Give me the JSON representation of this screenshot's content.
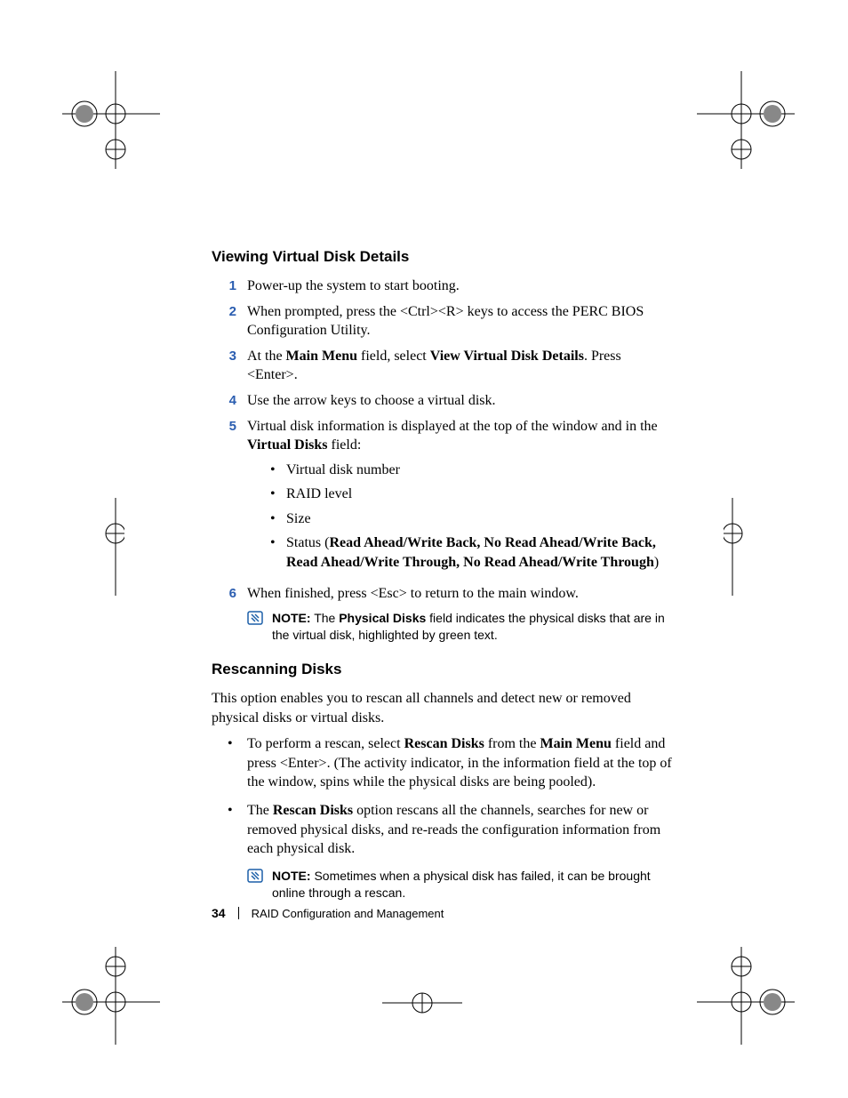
{
  "section1": {
    "heading": "Viewing Virtual Disk Details",
    "steps": [
      {
        "n": "1",
        "t1": "Power-up the system to start booting."
      },
      {
        "n": "2",
        "t1": "When prompted, press the <Ctrl><R> keys to access the PERC BIOS Configuration Utility."
      },
      {
        "n": "3",
        "t1": "At the ",
        "b1": "Main Menu",
        "t2": " field, select ",
        "b2": "View Virtual Disk Details",
        "t3": ". Press <Enter>."
      },
      {
        "n": "4",
        "t1": "Use the arrow keys to choose a virtual disk."
      },
      {
        "n": "5",
        "t1": "Virtual disk information is displayed at the top of the window and in the ",
        "b1": "Virtual Disks",
        "t2": " field:"
      },
      {
        "n": "6",
        "t1": "When finished, press <Esc> to return to the main window."
      }
    ],
    "sublist": [
      "Virtual disk number",
      "RAID level",
      "Size"
    ],
    "sublist_status": {
      "pre": "Status (",
      "bold": "Read Ahead/Write Back, No Read Ahead/Write Back, Read Ahead/Write Through, No Read Ahead/Write Through",
      "post": ")"
    },
    "note": {
      "label": "NOTE:",
      "t1": " The ",
      "b1": "Physical Disks",
      "t2": " field indicates the physical disks that are in the virtual disk, highlighted by green text."
    }
  },
  "section2": {
    "heading": "Rescanning Disks",
    "intro": "This option enables you to rescan all channels and detect new or removed physical disks or virtual disks.",
    "bullets": [
      {
        "t1": "To perform a rescan, select ",
        "b1": "Rescan Disks",
        "t2": " from the ",
        "b2": "Main Menu ",
        "t3": " field  and press <Enter>. (The activity indicator, in the information field at the top of the window, spins while the physical disks are being pooled)."
      },
      {
        "t1": "The ",
        "b1": "Rescan Disks",
        "t2": " option rescans all the channels, searches for new or removed physical disks, and re-reads the configuration information from each physical disk."
      }
    ],
    "note": {
      "label": "NOTE:",
      "t1": " Sometimes when a physical disk has failed, it can be brought online through a rescan."
    }
  },
  "footer": {
    "page": "34",
    "title": "RAID Configuration and Management"
  }
}
